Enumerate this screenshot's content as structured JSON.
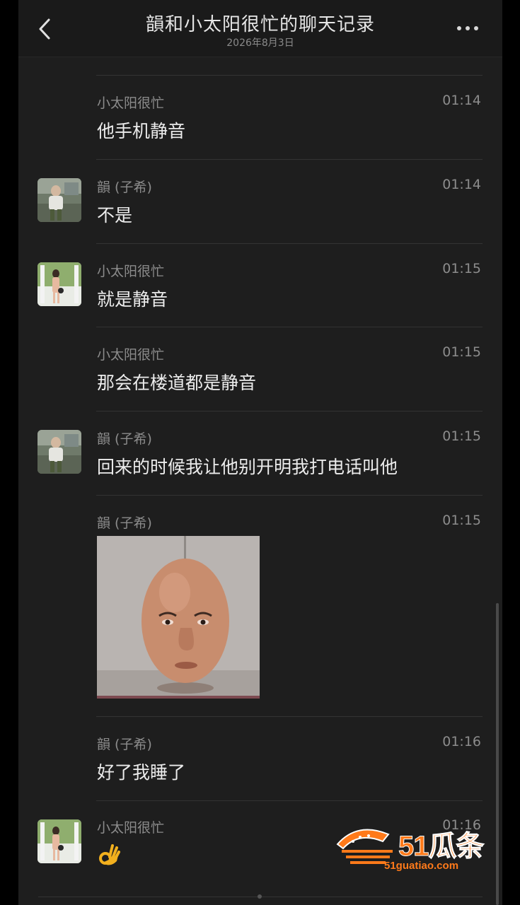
{
  "header": {
    "title": "韻和小太阳很忙的聊天记录",
    "subtitle": "2026年8月3日",
    "back_icon": "chevron-left-icon",
    "more_icon": "more-dots-icon"
  },
  "messages": [
    {
      "sender": "小太阳很忙",
      "time": "01:14",
      "text": "他手机静音"
    },
    {
      "sender": "韻 (子希)",
      "time": "01:14",
      "text": "不是"
    },
    {
      "sender": "小太阳很忙",
      "time": "01:15",
      "text": "就是静音"
    },
    {
      "sender": "小太阳很忙",
      "time": "01:15",
      "text": "那会在楼道都是静音"
    },
    {
      "sender": "韻 (子希)",
      "time": "01:15",
      "text": "回来的时候我让他别开明我打电话叫他"
    },
    {
      "sender": "韻 (子希)",
      "time": "01:15",
      "sticker": "egg-face-sticker"
    },
    {
      "sender": "韻 (子希)",
      "time": "01:16",
      "text": "好了我睡了"
    },
    {
      "sender": "小太阳很忙",
      "time": "01:16",
      "emoji": "ok-hand-emoji"
    }
  ],
  "watermark": {
    "brand": "51瓜条",
    "url": "51guatiao.com",
    "color": "#ff7a1a"
  },
  "colors": {
    "background": "#1e1e1e",
    "text": "#ececec",
    "meta": "#8c8c8c"
  }
}
